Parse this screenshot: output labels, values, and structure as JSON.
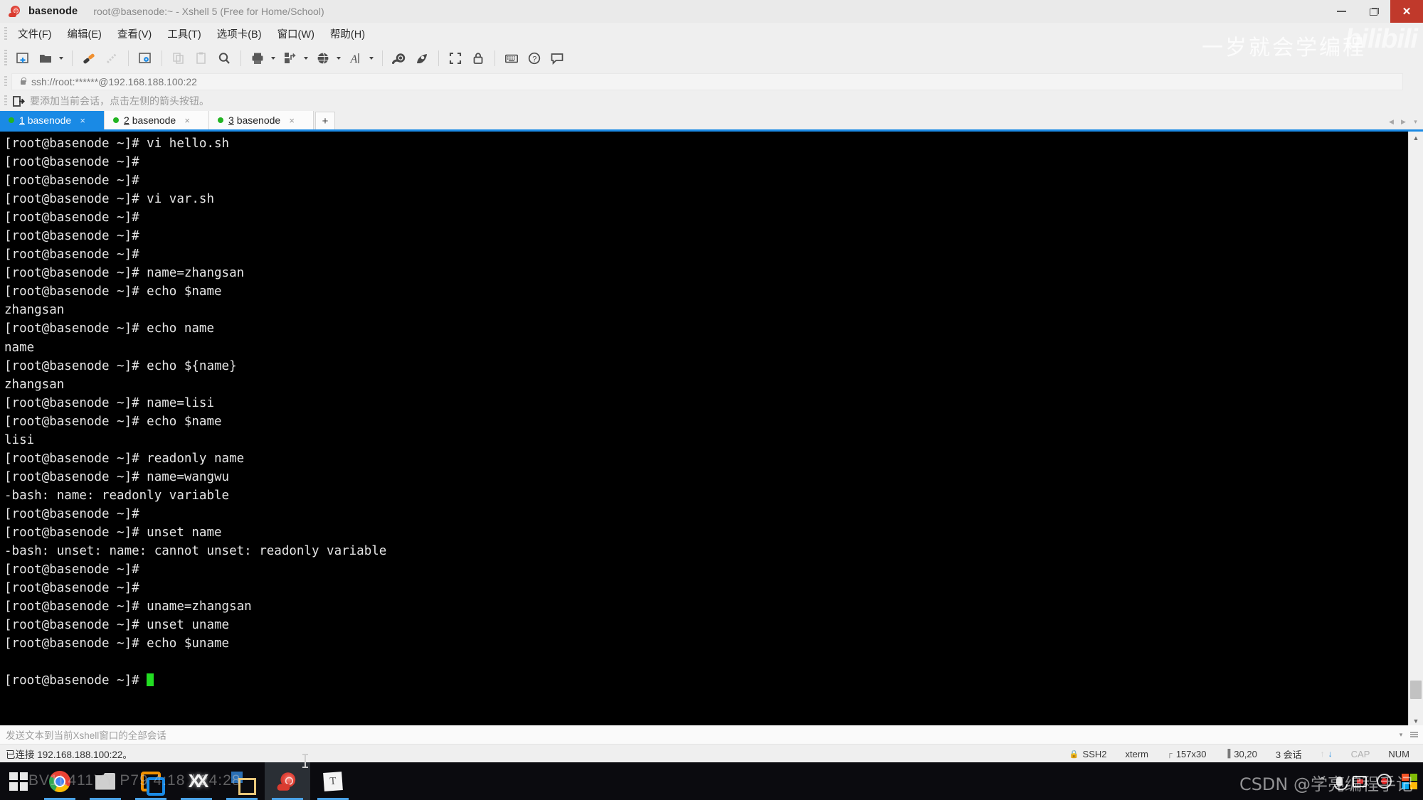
{
  "window": {
    "app_name": "basenode",
    "title": "root@basenode:~ - Xshell 5 (Free for Home/School)",
    "controls": {
      "minimize": "–",
      "restore": "❐",
      "close": "✕"
    }
  },
  "menu": {
    "items": [
      {
        "label": "文件(F)",
        "name": "menu-file"
      },
      {
        "label": "编辑(E)",
        "name": "menu-edit"
      },
      {
        "label": "查看(V)",
        "name": "menu-view"
      },
      {
        "label": "工具(T)",
        "name": "menu-tools"
      },
      {
        "label": "选项卡(B)",
        "name": "menu-tabs"
      },
      {
        "label": "窗口(W)",
        "name": "menu-window"
      },
      {
        "label": "帮助(H)",
        "name": "menu-help"
      }
    ]
  },
  "toolbar": {
    "icons": [
      "new-session-icon",
      "open-folder-icon",
      "connect-icon",
      "disconnect-icon",
      "session-properties-icon",
      "copy-icon",
      "paste-icon",
      "find-icon",
      "print-icon",
      "file-transfer-icon",
      "globe-icon",
      "font-icon",
      "xshell-icon",
      "xftp-icon",
      "fullscreen-icon",
      "lock-icon",
      "keyboard-icon",
      "help-icon",
      "comment-icon"
    ]
  },
  "address_bar": {
    "value": "ssh://root:******@192.168.188.100:22",
    "lock_icon": "lock-icon"
  },
  "hint_bar": {
    "icon": "add-session-icon",
    "text": "要添加当前会话，点击左侧的箭头按钮。"
  },
  "tabs": {
    "items": [
      {
        "num": "1",
        "label": "basenode",
        "active": true
      },
      {
        "num": "2",
        "label": "basenode",
        "active": false
      },
      {
        "num": "3",
        "label": "basenode",
        "active": false
      }
    ],
    "add_label": "+",
    "close_label": "×",
    "nav_prev": "◀",
    "nav_next": "▶",
    "nav_menu": "▾"
  },
  "terminal": {
    "prompt": "[root@basenode ~]#",
    "lines": [
      "[root@basenode ~]# vi hello.sh",
      "[root@basenode ~]#",
      "[root@basenode ~]#",
      "[root@basenode ~]# vi var.sh",
      "[root@basenode ~]#",
      "[root@basenode ~]#",
      "[root@basenode ~]#",
      "[root@basenode ~]# name=zhangsan",
      "[root@basenode ~]# echo $name",
      "zhangsan",
      "[root@basenode ~]# echo name",
      "name",
      "[root@basenode ~]# echo ${name}",
      "zhangsan",
      "[root@basenode ~]# name=lisi",
      "[root@basenode ~]# echo $name",
      "lisi",
      "[root@basenode ~]# readonly name",
      "[root@basenode ~]# name=wangwu",
      "-bash: name: readonly variable",
      "[root@basenode ~]#",
      "[root@basenode ~]# unset name",
      "-bash: unset: name: cannot unset: readonly variable",
      "[root@basenode ~]#",
      "[root@basenode ~]#",
      "[root@basenode ~]# uname=zhangsan",
      "[root@basenode ~]# unset uname",
      "[root@basenode ~]# echo $uname",
      ""
    ],
    "last_prompt": "[root@basenode ~]# ",
    "cursor": "block-cursor",
    "colors": {
      "background": "#000000",
      "foreground": "#e6e6e6",
      "cursor": "#22dd22"
    }
  },
  "scrollbar": {
    "up": "▲",
    "down": "▼",
    "name": "terminal-vertical-scrollbar"
  },
  "send_bar": {
    "placeholder": "发送文本到当前Xshell窗口的全部会话",
    "menu": "▾"
  },
  "status_bar": {
    "left": "已连接 192.168.188.100:22。",
    "items": [
      {
        "icon": "lock-icon",
        "label": "SSH2",
        "name": "status-protocol"
      },
      {
        "icon": "",
        "label": "xterm",
        "name": "status-terminal-type"
      },
      {
        "icon": "┌",
        "label": "157x30",
        "name": "status-window-size"
      },
      {
        "icon": "▐",
        "label": "30,20",
        "name": "status-cursor-position"
      },
      {
        "icon": "",
        "label": "3 会话",
        "name": "status-session-count"
      }
    ],
    "upload_arrow": "↑",
    "download_arrow": "↓",
    "cap": "CAP",
    "num": "NUM"
  },
  "taskbar": {
    "start_icon": "windows-start-icon",
    "items": [
      {
        "name": "taskbar-chrome",
        "icon": "chrome-icon",
        "running": true
      },
      {
        "name": "taskbar-explorer",
        "icon": "folder-icon",
        "running": true
      },
      {
        "name": "taskbar-virtualbox",
        "icon": "virtualbox-icon",
        "running": true
      },
      {
        "name": "taskbar-xmind",
        "icon": "xmind-icon",
        "running": true
      },
      {
        "name": "taskbar-editor",
        "icon": "editplus-icon",
        "running": true
      },
      {
        "name": "taskbar-xshell",
        "icon": "xshell-icon",
        "running": true,
        "active": true
      },
      {
        "name": "taskbar-typora",
        "icon": "typora-icon",
        "running": true
      }
    ],
    "tray": [
      {
        "name": "tray-expand-icon",
        "glyph": "⌃"
      },
      {
        "name": "tray-microphone-icon",
        "glyph": "mic"
      },
      {
        "name": "tray-screen-record-icon",
        "glyph": "rec-sq"
      },
      {
        "name": "tray-record-icon",
        "glyph": "rec-circle"
      },
      {
        "name": "tray-csdn-icon",
        "glyph": "csdn"
      }
    ]
  },
  "watermarks": {
    "top": "一岁就会学编程",
    "top_logo": "bilibili",
    "bottom": "CSDN @学亮编程手记",
    "taskbar_left": "BV1L411YY P79 4:18 / 24:28"
  }
}
